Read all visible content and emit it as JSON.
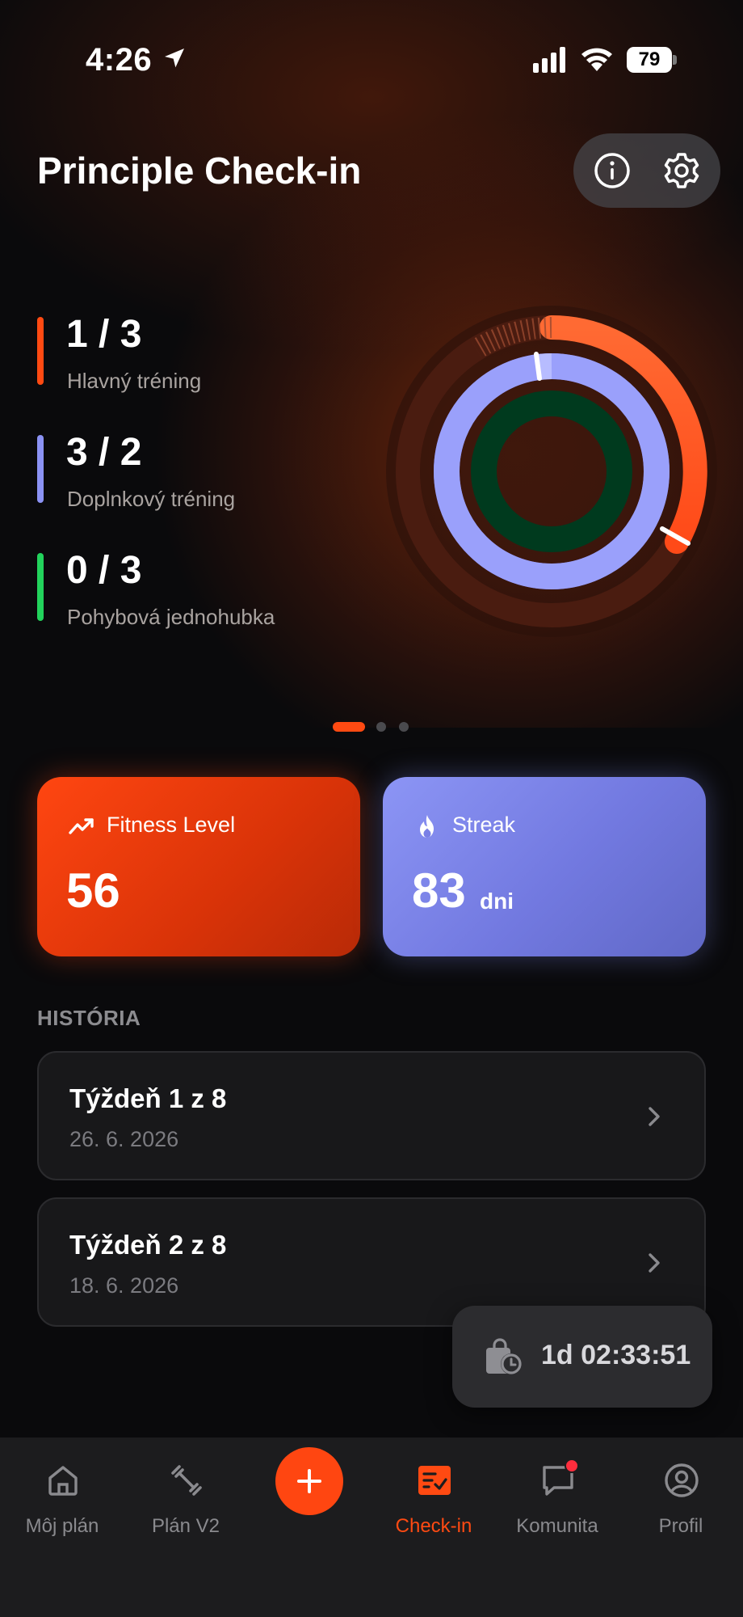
{
  "status_bar": {
    "time": "4:26",
    "battery": "79"
  },
  "header": {
    "title": "Principle Check-in"
  },
  "stats": [
    {
      "value": "1 / 3",
      "label": "Hlavný tréning",
      "color": "#ff4a12"
    },
    {
      "value": "3 / 2",
      "label": "Doplnkový tréning",
      "color": "#8b92f4"
    },
    {
      "value": "0 / 3",
      "label": "Pohybová jednohubka",
      "color": "#22d35c"
    }
  ],
  "rings": {
    "hlavny_progress": 0.333,
    "doplnkovy_progress": 1.5,
    "pohybova_progress": 0.0,
    "colors": {
      "outer": "#ff5a22",
      "middle": "#9aa0fb",
      "inner": "#003a1e"
    }
  },
  "pager": {
    "count": 3,
    "active_index": 0
  },
  "cards": {
    "fitness": {
      "label": "Fitness Level",
      "value": "56"
    },
    "streak": {
      "label": "Streak",
      "value": "83",
      "unit": "dni"
    }
  },
  "history": {
    "title": "HISTÓRIA",
    "items": [
      {
        "title": "Týždeň 1 z 8",
        "date": "26. 6. 2026"
      },
      {
        "title": "Týždeň 2 z 8",
        "date": "18. 6. 2026"
      }
    ]
  },
  "timer": {
    "text": "1d 02:33:51"
  },
  "tabs": [
    {
      "label": "Môj plán",
      "icon": "home-icon"
    },
    {
      "label": "Plán V2",
      "icon": "dumbbell-icon"
    },
    {
      "label": "",
      "icon": "plus-icon"
    },
    {
      "label": "Check-in",
      "icon": "checklist-icon",
      "active": true
    },
    {
      "label": "Komunita",
      "icon": "chat-icon",
      "badge": true
    },
    {
      "label": "Profil",
      "icon": "profile-icon"
    }
  ]
}
